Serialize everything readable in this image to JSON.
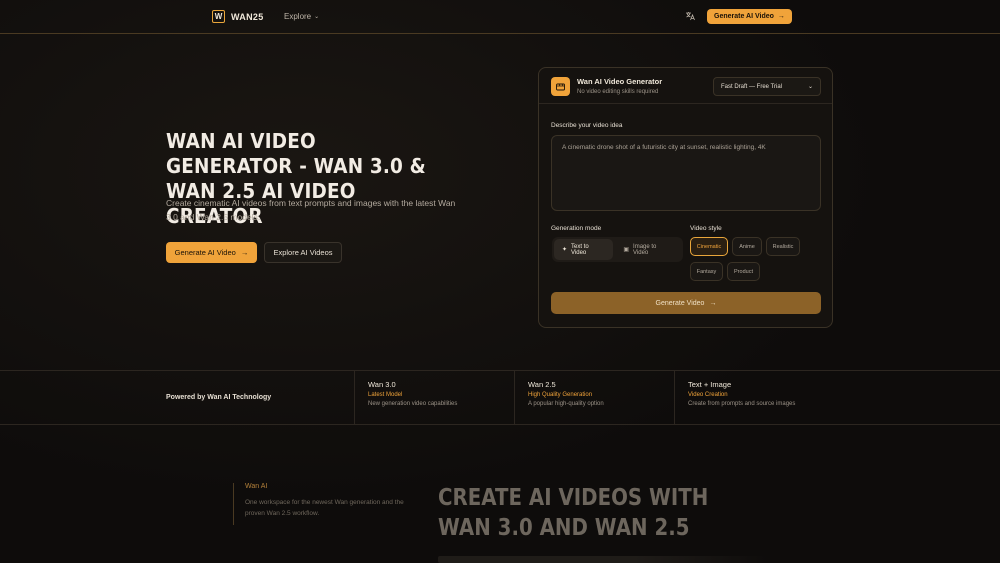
{
  "nav": {
    "logo_mark": "W",
    "brand": "WAN25",
    "explore": "Explore",
    "cta": "Generate AI Video"
  },
  "hero": {
    "title": "WAN AI VIDEO GENERATOR - WAN 3.0 & WAN 2.5 AI VIDEO CREATOR",
    "subtitle": "Create cinematic AI videos from text prompts and images with the latest Wan 3.0 and Wan 2.5 models.",
    "primary_button": "Generate AI Video",
    "secondary_button": "Explore AI Videos"
  },
  "generator": {
    "title": "Wan AI Video Generator",
    "subtitle": "No video editing skills required",
    "model_select": "Fast Draft — Free Trial",
    "prompt_label": "Describe your video idea",
    "prompt_placeholder": "A cinematic drone shot of a futuristic city at sunset, realistic lighting, 4K",
    "mode_label": "Generation mode",
    "modes": [
      "Text to Video",
      "Image to Video"
    ],
    "active_mode": "Text to Video",
    "style_label": "Video style",
    "styles": [
      "Cinematic",
      "Anime",
      "Realistic",
      "Fantasy",
      "Product"
    ],
    "active_style": "Cinematic",
    "generate_button": "Generate Video"
  },
  "band": {
    "powered": "Powered by Wan AI Technology",
    "stats": [
      {
        "name": "Wan 3.0",
        "tag": "Latest Model",
        "desc": "New generation video capabilities"
      },
      {
        "name": "Wan 2.5",
        "tag": "High Quality Generation",
        "desc": "A popular high-quality option"
      },
      {
        "name": "Text + Image",
        "tag": "Video Creation",
        "desc": "Create from prompts and source images"
      }
    ]
  },
  "lower": {
    "side_title": "Wan AI",
    "side_desc": "One workspace for the newest Wan generation and the proven Wan 2.5 workflow.",
    "title": "CREATE AI VIDEOS WITH WAN 3.0 AND WAN 2.5"
  },
  "colors": {
    "accent": "#f0a33a",
    "background": "#0e0c0b",
    "card": "#15120f"
  }
}
